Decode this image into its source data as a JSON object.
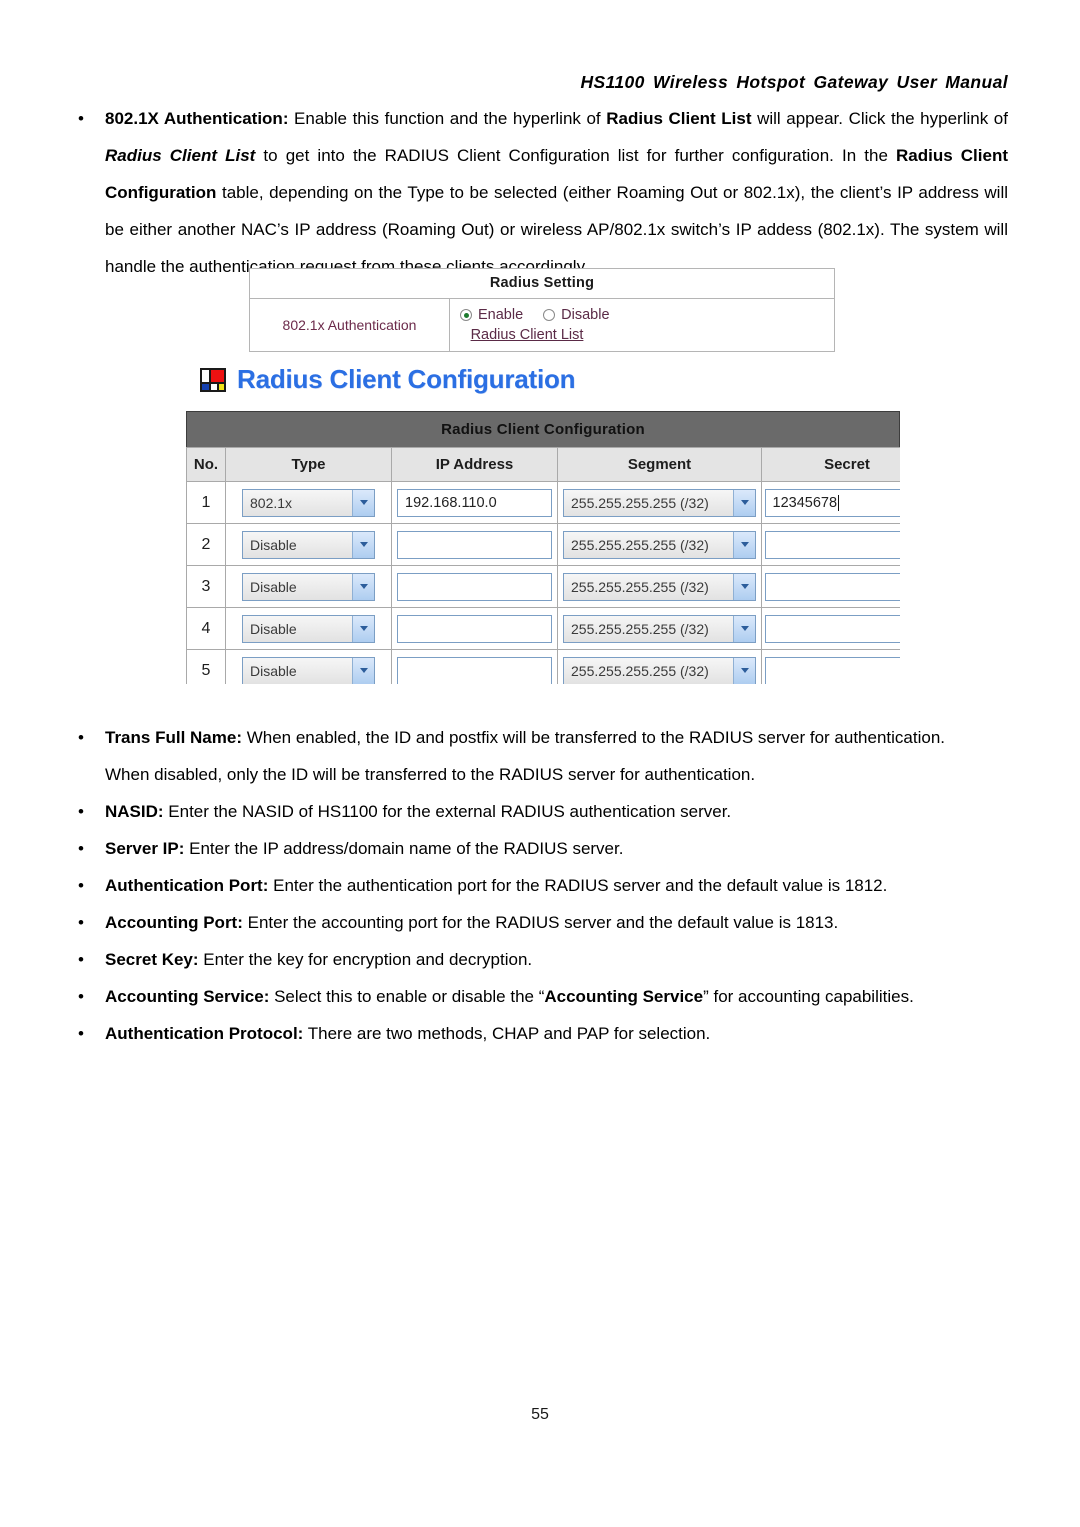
{
  "header": {
    "running_title": "HS1100 Wireless Hotspot Gateway User Manual"
  },
  "intro": {
    "bullet_glyph": "•",
    "term": "802.1X Authentication:",
    "line1_rest": " Enable this function and the hyperlink of ",
    "emph1": "Radius Client List",
    "line1_tail": " will appear. Click the hyperlink of ",
    "emph2": "Radius Client List",
    "line2_tail": " to get into the RADIUS Client Configuration list for further configuration. In the ",
    "emph3": "Radius Client Configuration",
    "line3_tail": " table, depending on the Type to be selected (either Roaming Out or 802.1x), the client’s IP address will be either another NAC’s IP address (Roaming Out) or wireless AP/802.1x switch’s IP addess (802.1x). The system will handle the authentication request from these clients accordingly."
  },
  "radius_setting": {
    "title": "Radius Setting",
    "row_label": "802.1x Authentication",
    "enable_label": "Enable",
    "disable_label": "Disable",
    "selected": "Enable",
    "link_label": "Radius Client List",
    "label_color": "#6b2a4a",
    "radio_dot_color": "#1d7a2e"
  },
  "section": {
    "heading": "Radius Client Configuration",
    "heading_color": "#2b6fe3",
    "icon": "mondrian-icon"
  },
  "client_table": {
    "title": "Radius Client Configuration",
    "titlebar_color": "#6a6a6a",
    "columns": [
      "No.",
      "Type",
      "IP Address",
      "Segment",
      "Secret"
    ],
    "rows": [
      {
        "no": "1",
        "type": "802.1x",
        "ip": "192.168.110.0",
        "segment": "255.255.255.255 (/32)",
        "secret": "12345678",
        "focused": true
      },
      {
        "no": "2",
        "type": "Disable",
        "ip": "",
        "segment": "255.255.255.255 (/32)",
        "secret": "",
        "focused": false
      },
      {
        "no": "3",
        "type": "Disable",
        "ip": "",
        "segment": "255.255.255.255 (/32)",
        "secret": "",
        "focused": false
      },
      {
        "no": "4",
        "type": "Disable",
        "ip": "",
        "segment": "255.255.255.255 (/32)",
        "secret": "",
        "focused": false
      },
      {
        "no": "5",
        "type": "Disable",
        "ip": "",
        "segment": "255.255.255.255 (/32)",
        "secret": "",
        "focused": false
      }
    ]
  },
  "bullets": [
    {
      "glyph": "•",
      "term": "Trans Full Name:",
      "text": " When enabled, the ID and postfix will be transferred to the RADIUS server for authentication.",
      "continuation": "When disabled, only the ID will be transferred to the RADIUS server for authentication."
    },
    {
      "glyph": "•",
      "term": "NASID:",
      "text": " Enter the NASID of HS1100 for the external RADIUS authentication server.",
      "continuation": ""
    },
    {
      "glyph": "•",
      "term": "Server IP:",
      "text": " Enter the IP address/domain name of the RADIUS server.",
      "continuation": ""
    },
    {
      "glyph": "•",
      "term": "Authentication Port:",
      "text": " Enter the authentication port for the RADIUS server and the default value is 1812.",
      "continuation": ""
    },
    {
      "glyph": "•",
      "term": "Accounting Port:",
      "text": " Enter the accounting port for the RADIUS server and the default value is 1813.",
      "continuation": ""
    },
    {
      "glyph": "•",
      "term": "Secret Key:",
      "text": " Enter the key for encryption and decryption.",
      "continuation": ""
    },
    {
      "glyph": "•",
      "term": "Accounting Service:",
      "text": " Select this to enable or disable the “Accounting Service” for accounting capabilities.",
      "emph": "Accounting Service",
      "text_pre": " Select this to enable or disable the “",
      "text_post": "” for accounting capabilities.",
      "continuation": ""
    },
    {
      "glyph": "•",
      "term": "Authentication Protocol:",
      "text": " There are two methods, CHAP and PAP for selection.",
      "continuation": ""
    }
  ],
  "footer": {
    "page_number": "55"
  }
}
